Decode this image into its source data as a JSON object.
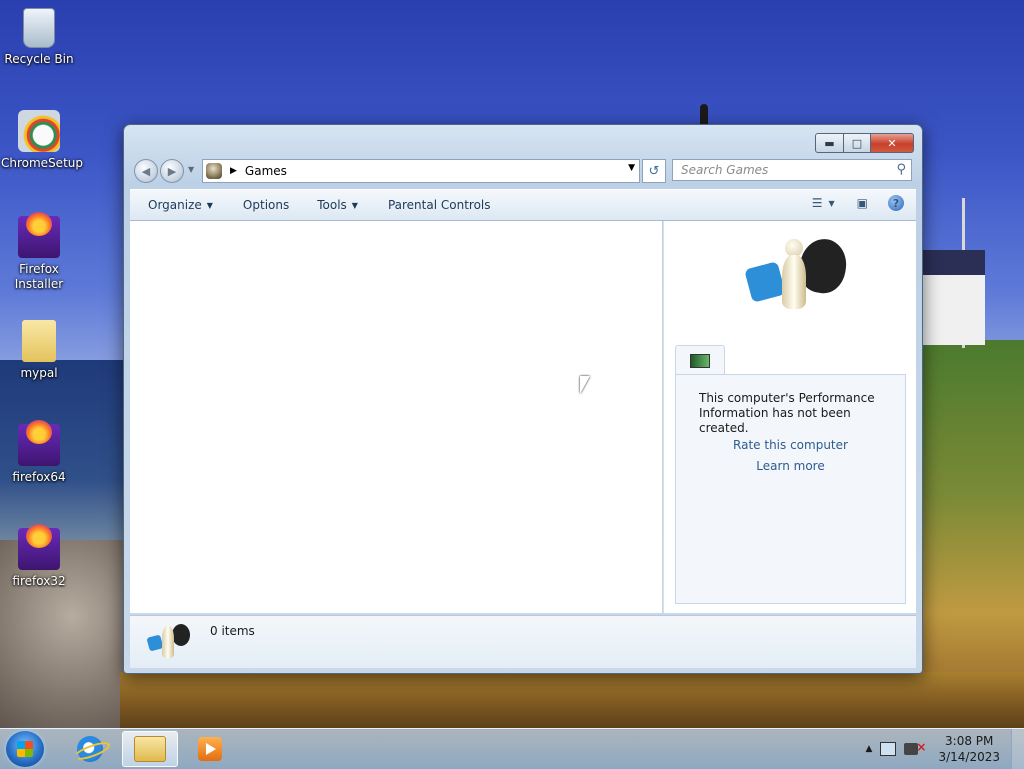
{
  "desktop": {
    "icons": [
      {
        "label": "Recycle Bin"
      },
      {
        "label": "ChromeSetup"
      },
      {
        "label": "Firefox Installer"
      },
      {
        "label": "mypal"
      },
      {
        "label": "firefox64"
      },
      {
        "label": "firefox32"
      }
    ]
  },
  "window": {
    "address": {
      "path": "Games"
    },
    "search": {
      "placeholder": "Search Games"
    },
    "toolbar": {
      "organize": "Organize",
      "options": "Options",
      "tools": "Tools",
      "parental_controls": "Parental Controls"
    },
    "preview": {
      "message": "This computer's Performance Information has not been created.",
      "rate_link": "Rate this computer",
      "learn_link": "Learn more"
    },
    "status": {
      "count": "0 items"
    }
  },
  "taskbar": {
    "clock": {
      "time": "3:08 PM",
      "date": "3/14/2023"
    }
  },
  "colors": {
    "accent": "#2d5c8f",
    "close_button": "#c7402a"
  }
}
